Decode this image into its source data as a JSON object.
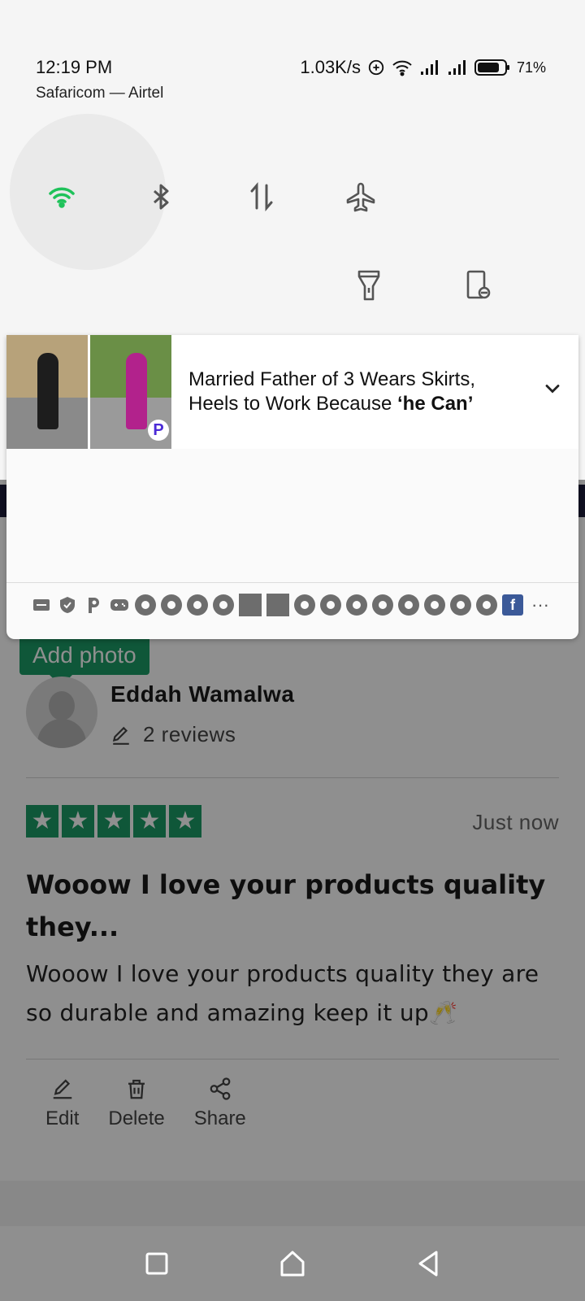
{
  "status_bar": {
    "time": "12:19 PM",
    "network_speed": "1.03K/s",
    "battery_percent": "71%",
    "carriers": "Safaricom — Airtel"
  },
  "quick_settings": {
    "tiles": [
      "wifi-icon",
      "bluetooth-icon",
      "mobile-data-icon",
      "airplane-mode-icon",
      "flashlight-icon",
      "screen-rotation-icon"
    ],
    "wifi_active_color": "#1fc25a"
  },
  "notification": {
    "title_prefix": "Married Father of 3 Wears Skirts, Heels to Work Because ",
    "title_bold": "‘he Can’",
    "app_badge": "P",
    "icon_row": [
      "message-icon",
      "shield-icon",
      "p-icon",
      "game-icon",
      "chrome-icon",
      "chrome-icon",
      "chrome-icon",
      "chrome-icon",
      "image-icon",
      "image-icon",
      "chrome-icon",
      "chrome-icon",
      "chrome-icon",
      "chrome-icon",
      "chrome-icon",
      "chrome-icon",
      "chrome-icon",
      "chrome-icon",
      "facebook-icon",
      "more-icon"
    ],
    "facebook_letter": "f",
    "more": "···"
  },
  "review": {
    "add_photo": "Add photo",
    "reviewer_name": "Eddah Wamalwa",
    "reviews_count": "2 reviews",
    "rating": 5,
    "time": "Just now",
    "title": "Wooow I love your products quality they...",
    "body": "Wooow I love your products quality they are so durable and amazing keep it up🥂",
    "actions": {
      "edit": "Edit",
      "delete": "Delete",
      "share": "Share"
    },
    "brand_color": "#1c9c66"
  },
  "nav_bar": [
    "recents-icon",
    "home-icon",
    "back-icon"
  ]
}
